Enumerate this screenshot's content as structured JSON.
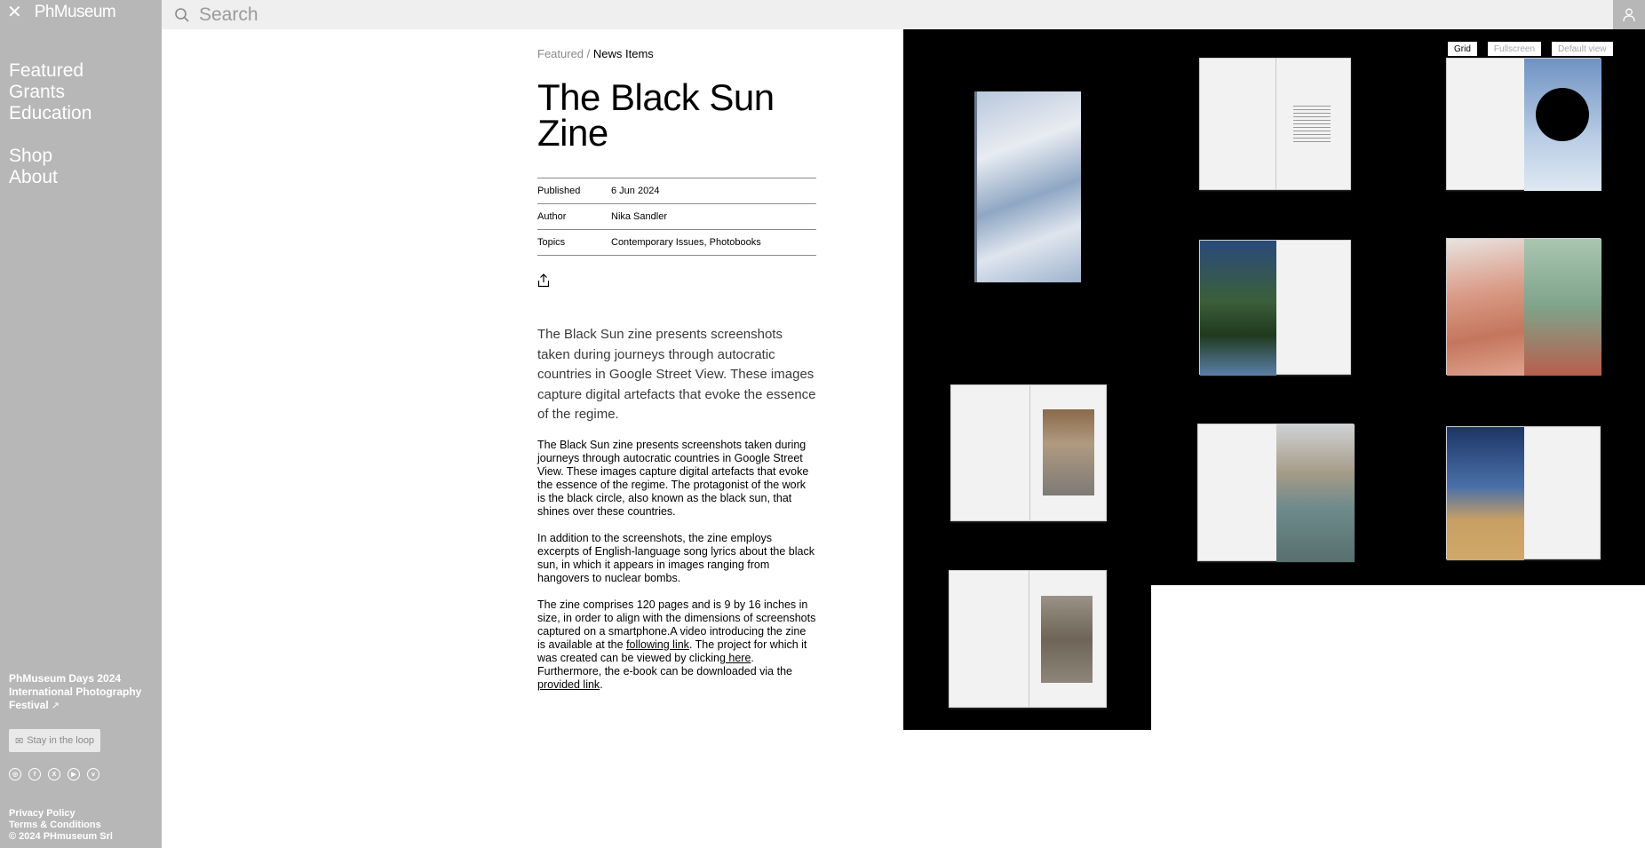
{
  "sidebar": {
    "logo": "PhMuseum",
    "nav": {
      "featured": "Featured",
      "grants": "Grants",
      "education": "Education",
      "shop": "Shop",
      "about": "About"
    },
    "festival": "PhMuseum Days 2024 International Photography Festival",
    "loop_button": "Stay in the loop",
    "socials": [
      "instagram-icon",
      "facebook-icon",
      "x-icon",
      "youtube-icon",
      "vimeo-icon"
    ],
    "legal": {
      "privacy": "Privacy Policy",
      "terms": "Terms & Conditions",
      "copyright": "© 2024 PHmuseum Srl"
    }
  },
  "search": {
    "placeholder": "Search"
  },
  "article": {
    "breadcrumb": {
      "parent": "Featured",
      "separator": " / ",
      "current": "News Items"
    },
    "title": "The Black Sun Zine",
    "meta": {
      "published_label": "Published",
      "published_value": "6 Jun 2024",
      "author_label": "Author",
      "author_value": "Nika Sandler",
      "topics_label": "Topics",
      "topics_value": "Contemporary Issues, Photobooks"
    },
    "lead": "The Black Sun zine presents screenshots taken during journeys through autocratic countries in Google Street View. These images capture digital artefacts that evoke the essence of the regime.",
    "p1": "The Black Sun zine presents screenshots taken during journeys through autocratic countries in Google Street View. These images capture digital artefacts that evoke the essence of the regime. The protagonist of the work is the black circle, also known as the black sun, that shines over these countries.",
    "p2": "In addition to the screenshots, the zine employs excerpts of English-language song lyrics about the black sun, in which it appears in images ranging from hangovers to nuclear bombs.",
    "p3": {
      "t1": "The zine comprises 120 pages and is 9 by 16 inches in size, in order to align with the dimensions of screenshots captured on a smartphone.A video introducing the zine is available at the ",
      "link1": "following link",
      "t2": ". The project for which it was created can be viewed by clicking",
      "link2": " here",
      "t3": ". Furthermore, the e-book can be downloaded via the ",
      "link3": "provided link",
      "t4": "."
    }
  },
  "gallery": {
    "views": {
      "grid": "Grid",
      "fullscreen": "Fullscreen",
      "default": "Default view"
    },
    "active_view": "Grid",
    "background": "#000000"
  }
}
